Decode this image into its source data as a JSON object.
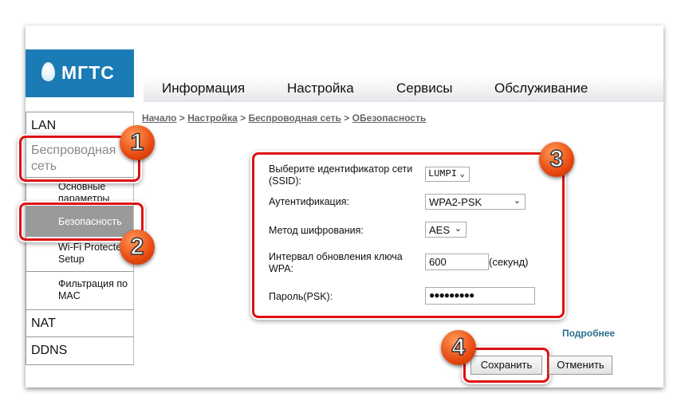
{
  "brand": {
    "name": "МГТС",
    "color": "#1b7bb5"
  },
  "nav": [
    "Информация",
    "Настройка",
    "Сервисы",
    "Обслуживание"
  ],
  "sidebar": {
    "lan": "LAN",
    "wireless": "Беспроводная сеть",
    "basic": "Основные параметры",
    "security": "Безопасность",
    "wps": "Wi-Fi Protected Setup",
    "mac_filter": "Фильтрация по MAC",
    "nat": "NAT",
    "ddns": "DDNS"
  },
  "breadcrumb": [
    "Начало",
    "Настройка",
    "Беспроводная сеть",
    "ОБезопасность"
  ],
  "breadcrumb_sep": ">",
  "form": {
    "ssid_label": "Выберите идентификатор сети (SSID):",
    "ssid_value": "LUMPI",
    "auth_label": "Аутентификация:",
    "auth_value": "WPA2-PSK",
    "enc_label": "Метод шифрования:",
    "enc_value": "AES",
    "interval_label": "Интервал обновления ключа WPA:",
    "interval_value": "600",
    "interval_unit": "(секунд)",
    "psk_label": "Пароль(PSK):",
    "psk_value": "●●●●●●●●●"
  },
  "more_link": "Подробнее",
  "buttons": {
    "save": "Сохранить",
    "cancel": "Отменить"
  },
  "badges": [
    "1",
    "2",
    "3",
    "4"
  ],
  "highlight_color": "#e01010"
}
